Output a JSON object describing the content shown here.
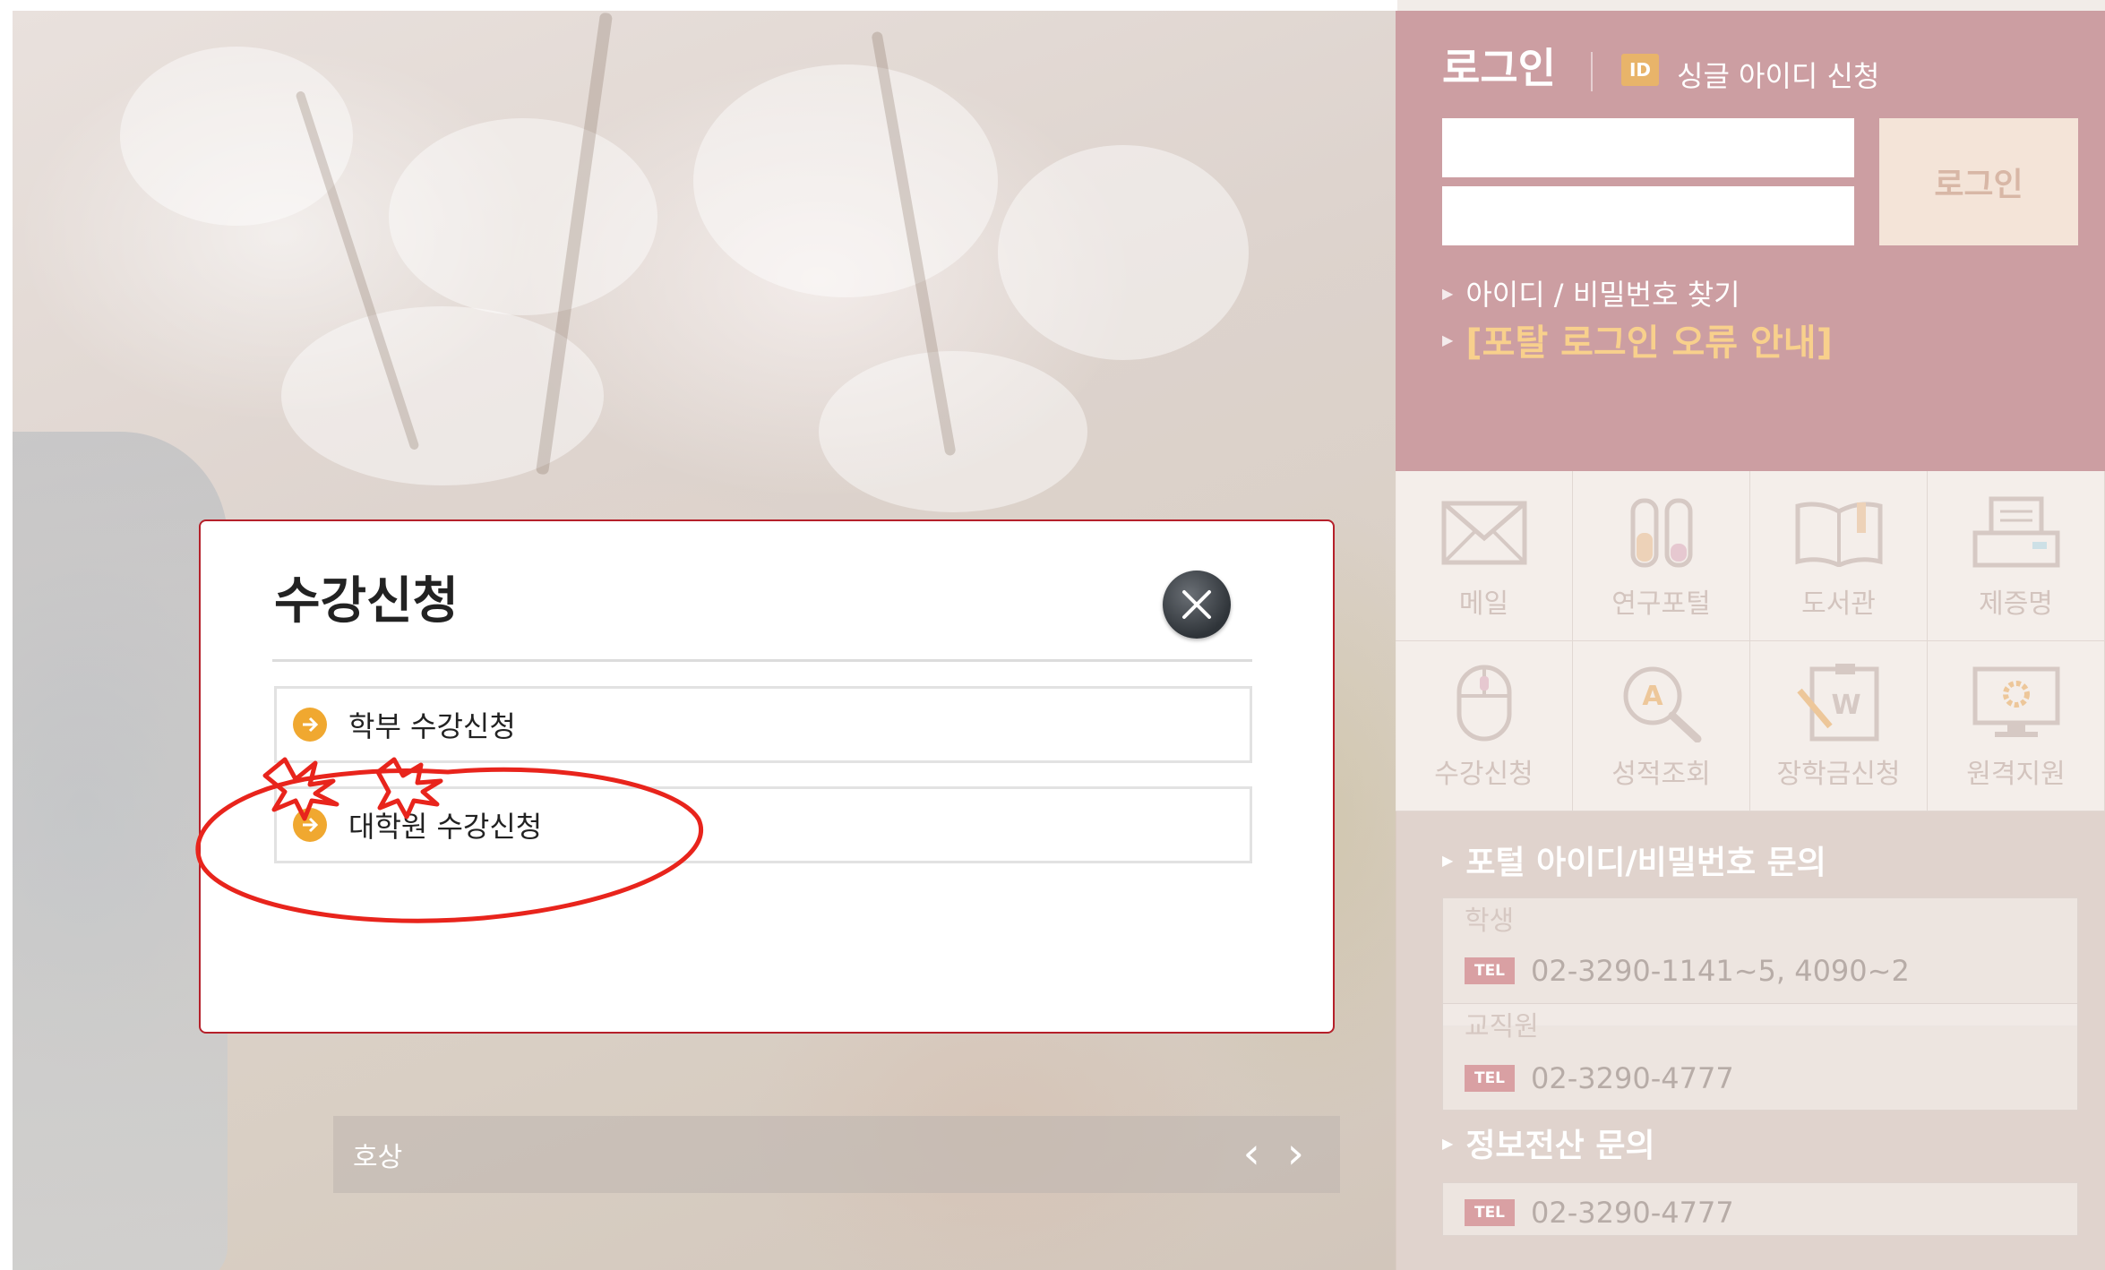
{
  "login": {
    "title": "로그인",
    "id_badge": "ID",
    "single_id_link": "싱글 아이디 신청",
    "id_input_value": "",
    "pw_input_value": "",
    "login_button": "로그인",
    "find_link": "아이디 / 비밀번호 찾기",
    "error_link": "[포탈 로그인 오류 안내]"
  },
  "quick_menu": [
    {
      "label": "메일",
      "icon": "mail-icon"
    },
    {
      "label": "연구포털",
      "icon": "test-tubes-icon"
    },
    {
      "label": "도서관",
      "icon": "book-icon"
    },
    {
      "label": "제증명",
      "icon": "printer-icon"
    },
    {
      "label": "수강신청",
      "icon": "mouse-icon"
    },
    {
      "label": "성적조회",
      "icon": "magnifier-grade-icon"
    },
    {
      "label": "장학금신청",
      "icon": "scholarship-document-icon"
    },
    {
      "label": "원격지원",
      "icon": "monitor-gear-icon"
    }
  ],
  "contact": {
    "portal_head": "포털 아이디/비밀번호 문의",
    "student_label": "학생",
    "student_tel": "02-3290-1141~5, 4090~2",
    "staff_label": "교직원",
    "staff_tel": "02-3290-4777",
    "it_head": "정보전산 문의",
    "it_tel": "02-3290-4777",
    "tel_badge": "TEL"
  },
  "slider": {
    "caption": "호상",
    "prev": "‹",
    "next": "›"
  },
  "modal": {
    "title": "수강신청",
    "options": [
      {
        "label": "학부 수강신청"
      },
      {
        "label": "대학원 수강신청"
      }
    ]
  },
  "colors": {
    "login_panel": "#cc9ea2",
    "modal_border": "#b5202a",
    "option_icon": "#f0a830",
    "annotation": "#e8241c"
  }
}
